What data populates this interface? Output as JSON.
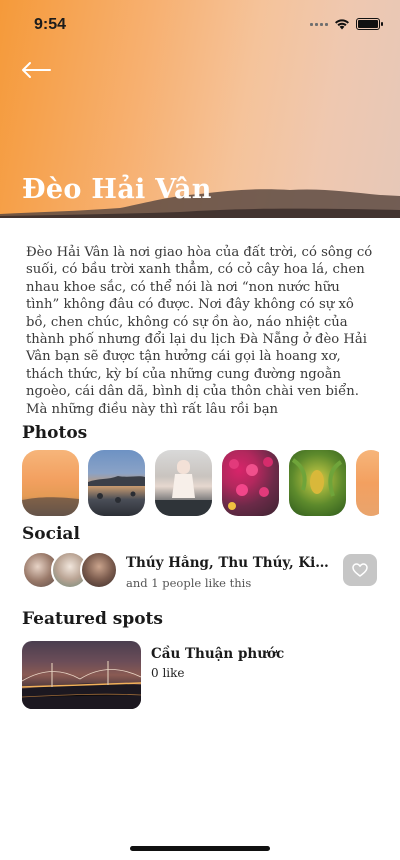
{
  "status_bar": {
    "time": "9:54",
    "icons": [
      "signal-icon",
      "wifi-icon",
      "battery-icon"
    ]
  },
  "header": {
    "back_icon": "back-arrow-icon",
    "title": "Đèo Hải Vân"
  },
  "description": "Đèo Hải Vân là nơi giao hòa của đất trời, có sông có suối, có bầu trời xanh thẳm, có cỏ cây hoa lá, chen nhau khoe sắc, có thể nói là nơi “non nước hữu tình” không đâu có được. Nơi đây không có sự xô bồ, chen chúc, không có sự ồn ào, náo nhiệt của thành phố nhưng đổi lại du lịch Đà Nẵng ở đèo Hải Vân bạn sẽ được tận hưởng cái gọi là hoang xơ, thách thức, kỳ bí của những cung đường ngoằn ngoèo, cái dân dã, bình dị của thôn chài ven biển. Mà những điều này thì rất lâu rồi bạn",
  "photos": {
    "title": "Photos"
  },
  "social": {
    "title": "Social",
    "names": "Thúy Hằng, Thu Thúy, Kiều Nhi",
    "like_text": "and 1 people like this",
    "like_icon": "heart-icon"
  },
  "featured": {
    "title": "Featured spots",
    "spots": [
      {
        "name": "Cầu Thuận phước",
        "likes": "0 like"
      }
    ]
  },
  "colors": {
    "hero_start": "#f59a3a",
    "hero_end": "#e6c8b8",
    "like_button_bg": "#c6c6c6"
  }
}
